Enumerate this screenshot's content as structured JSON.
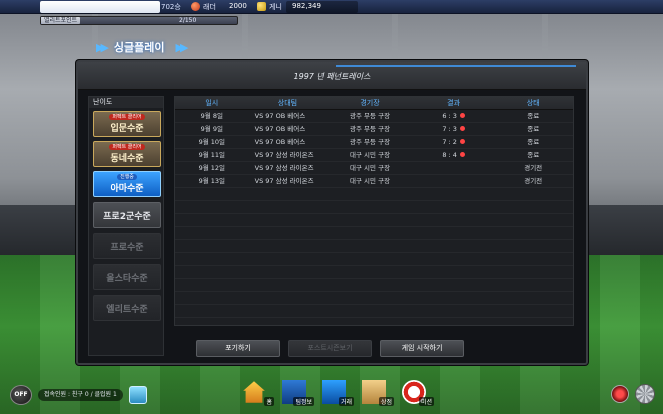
{
  "topbar": {
    "record": "702승",
    "ladder_label": "래더",
    "ladder_value": "2000",
    "money_label": "게니",
    "money_value": "982,349",
    "progress_label": "열리트포인트",
    "progress_value": "2/150",
    "progress_fraction": 0.013
  },
  "mode_title": "싱글플레이",
  "panel": {
    "title": "1997 년 페넌트레이스",
    "difficulty_header": "난이도",
    "difficulties": [
      {
        "label": "입문수준",
        "badge": "퍼펙트 클리어",
        "style": "gold"
      },
      {
        "label": "동네수준",
        "badge": "퍼펙트 클리어",
        "style": "gold"
      },
      {
        "label": "아마수준",
        "badge": "진행중",
        "style": "blue"
      },
      {
        "label": "프로2군수준",
        "badge": "",
        "style": "grey"
      },
      {
        "label": "프로수준",
        "badge": "",
        "style": "dark"
      },
      {
        "label": "올스타수준",
        "badge": "",
        "style": "dark"
      },
      {
        "label": "엘리트수준",
        "badge": "",
        "style": "dark"
      }
    ],
    "columns": [
      "일시",
      "상대팀",
      "경기장",
      "결과",
      "상태"
    ],
    "rows": [
      {
        "date": "9월 8일",
        "opp": "VS  97 OB 베어스",
        "park": "광주 무등 구장",
        "result": "6 : 3",
        "win": true,
        "status": "종료"
      },
      {
        "date": "9월 9일",
        "opp": "VS  97 OB 베어스",
        "park": "광주 무등 구장",
        "result": "7 : 3",
        "win": true,
        "status": "종료"
      },
      {
        "date": "9월 10일",
        "opp": "VS  97 OB 베어스",
        "park": "광주 무등 구장",
        "result": "7 : 2",
        "win": true,
        "status": "종료"
      },
      {
        "date": "9월 11일",
        "opp": "VS  97 삼성 라이온즈",
        "park": "대구 시민 구장",
        "result": "8 : 4",
        "win": true,
        "status": "종료"
      },
      {
        "date": "9월 12일",
        "opp": "VS  97 삼성 라이온즈",
        "park": "대구 시민 구장",
        "result": "",
        "win": false,
        "status": "경기전"
      },
      {
        "date": "9월 13일",
        "opp": "VS  97 삼성 라이온즈",
        "park": "대구 시민 구장",
        "result": "",
        "win": false,
        "status": "경기전"
      }
    ],
    "buttons": {
      "give_up": "포기하기",
      "postseason": "포스트시즌보기",
      "start": "게임 시작하기"
    }
  },
  "bottom": {
    "off_label": "OFF",
    "info": "접속인원 : 친구 0 / 클럽원 1",
    "dock": [
      {
        "label": "홈",
        "icon": "home-icon"
      },
      {
        "label": "팀정보",
        "icon": "team-icon"
      },
      {
        "label": "거래",
        "icon": "trade-icon"
      },
      {
        "label": "상점",
        "icon": "shop-icon"
      },
      {
        "label": "미션",
        "icon": "mission-icon"
      }
    ]
  }
}
